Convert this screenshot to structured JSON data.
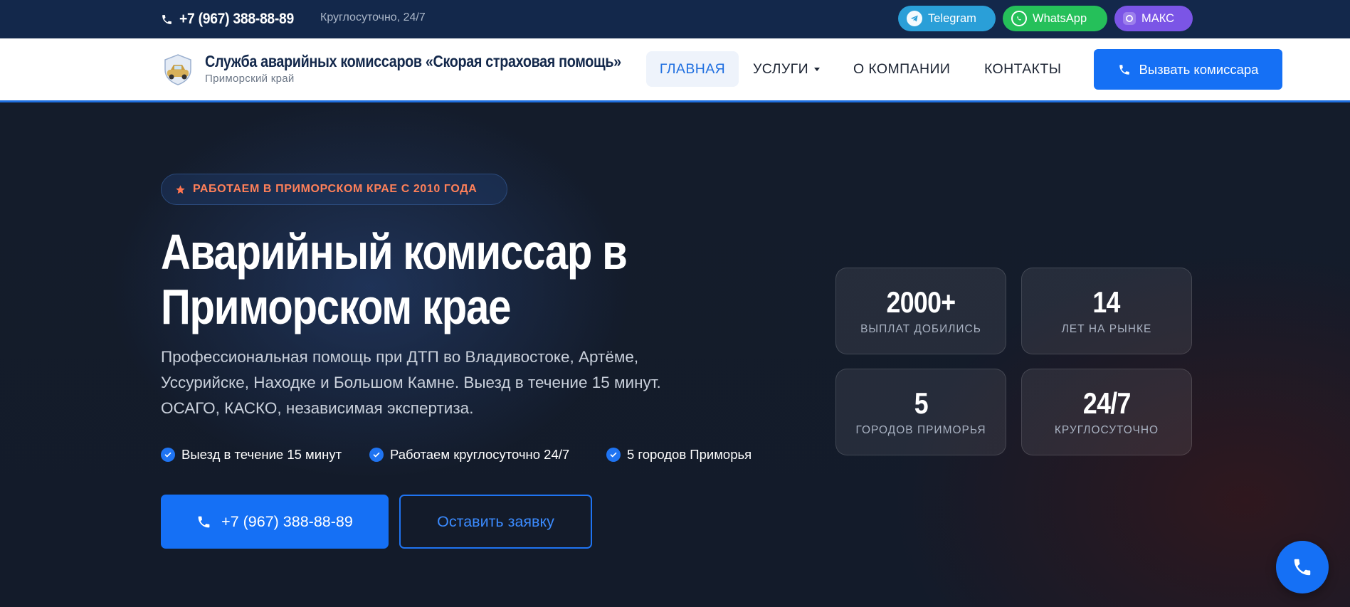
{
  "topbar": {
    "phone": "+7 (967) 388-88-89",
    "hours": "Круглосуточно, 24/7",
    "messengers": [
      {
        "label": "Telegram",
        "icon": "telegram-icon",
        "color": "#2a9fd8"
      },
      {
        "label": "WhatsApp",
        "icon": "whatsapp-icon",
        "color": "#25c05a"
      },
      {
        "label": "МАКС",
        "icon": "max-icon",
        "color": "#7b55e6"
      }
    ]
  },
  "header": {
    "brand_title": "Служба аварийных комиссаров «Скорая страховая помощь»",
    "brand_subtitle": "Приморский край",
    "nav": [
      {
        "label": "ГЛАВНАЯ",
        "active": true
      },
      {
        "label": "УСЛУГИ",
        "has_dropdown": true
      },
      {
        "label": "О КОМПАНИИ"
      },
      {
        "label": "КОНТАКТЫ"
      }
    ],
    "cta_label": "Вызвать комиссара",
    "accent_color": "#1570f5"
  },
  "hero": {
    "badge": "РАБОТАЕМ В ПРИМОРСКОМ КРАЕ С 2010 ГОДА",
    "title_line1": "Аварийный комиссар в",
    "title_line2": "Приморском крае",
    "description": "Профессиональная помощь при ДТП во Владивостоке, Артёме, Уссурийске, Находке и Большом Камне. Выезд в течение 15 минут. ОСАГО, КАСКО, независимая экспертиза.",
    "features": [
      "Выезд в течение 15 минут",
      "Работаем круглосуточно 24/7",
      "5 городов Приморья"
    ],
    "primary_button": "+7 (967) 388-88-89",
    "secondary_button": "Оставить заявку",
    "stats": [
      {
        "value": "2000+",
        "label": "ВЫПЛАТ ДОБИЛИСЬ"
      },
      {
        "value": "14",
        "label": "ЛЕТ НА РЫНКЕ"
      },
      {
        "value": "5",
        "label": "ГОРОДОВ ПРИМОРЬЯ"
      },
      {
        "value": "24/7",
        "label": "КРУГЛОСУТОЧНО"
      }
    ]
  }
}
